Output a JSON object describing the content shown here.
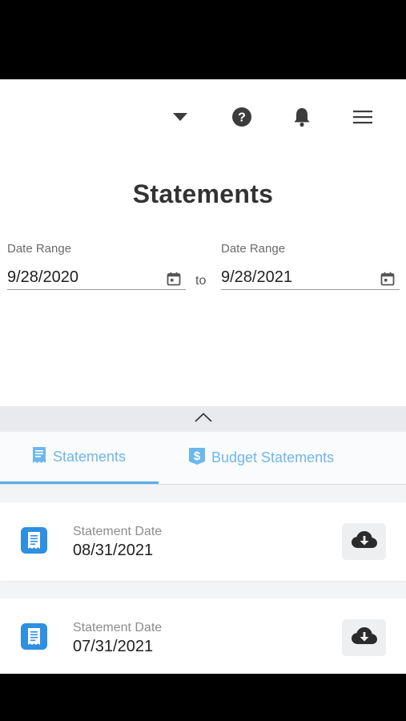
{
  "header": {
    "icons": [
      "chevron-down-icon",
      "help-circle-icon",
      "bell-icon",
      "hamburger-menu-icon"
    ]
  },
  "page": {
    "title": "Statements"
  },
  "filters": {
    "from": {
      "label": "Date Range",
      "value": "9/28/2020"
    },
    "separator": "to",
    "to": {
      "label": "Date Range",
      "value": "9/28/2021"
    }
  },
  "tabs": [
    {
      "label": "Statements",
      "icon": "statement-doc-icon",
      "active": true
    },
    {
      "label": "Budget Statements",
      "icon": "budget-dollar-icon",
      "active": false
    }
  ],
  "statements": [
    {
      "label": "Statement Date",
      "date": "08/31/2021"
    },
    {
      "label": "Statement Date",
      "date": "07/31/2021"
    }
  ],
  "colors": {
    "accent": "#5aaee8",
    "tab_text": "#6db7ec",
    "doc_icon": "#2f8fe0",
    "icon_dark": "#3c3c3c"
  }
}
